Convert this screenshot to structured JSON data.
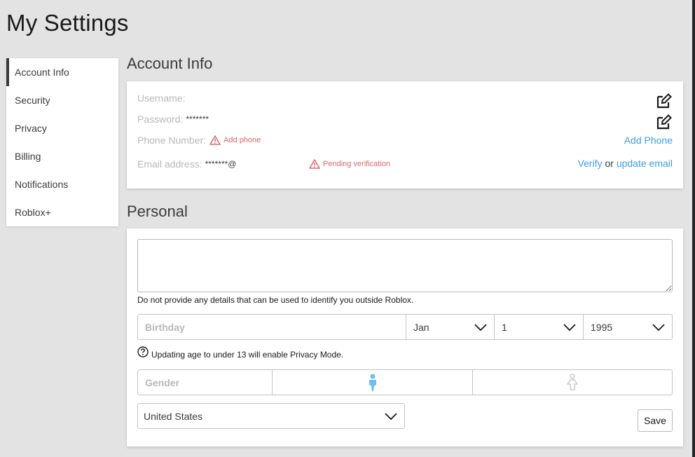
{
  "page": {
    "title": "My Settings"
  },
  "sidebar": {
    "items": [
      {
        "label": "Account Info",
        "active": true
      },
      {
        "label": "Security"
      },
      {
        "label": "Privacy"
      },
      {
        "label": "Billing"
      },
      {
        "label": "Notifications"
      },
      {
        "label": "Roblox+"
      }
    ]
  },
  "account_info": {
    "title": "Account Info",
    "username_label": "Username:",
    "username_value": "",
    "password_label": "Password:",
    "password_value": "*******",
    "phone_label": "Phone Number:",
    "phone_warning": "Add phone",
    "add_phone_link": "Add Phone",
    "email_label": "Email address:",
    "email_value": "*******@",
    "email_warning": "Pending verification",
    "verify_link": "Verify",
    "or_text": "or",
    "update_email_link": "update email",
    "icons": {
      "edit": "edit-icon",
      "warning": "warning-triangle-icon"
    }
  },
  "personal": {
    "title": "Personal",
    "bio_value": "",
    "bio_hint": "Do not provide any details that can be used to identify you outside Roblox.",
    "birthday_label": "Birthday",
    "birth_month": "Jan",
    "birth_day": "1",
    "birth_year": "1995",
    "age_hint": "Updating age to under 13 will enable Privacy Mode.",
    "gender_label": "Gender",
    "gender_selected": "male",
    "country": "United States",
    "save_label": "Save",
    "colors": {
      "male_selected": "#66bff5",
      "female_unselected": "#c8c8c8"
    }
  }
}
